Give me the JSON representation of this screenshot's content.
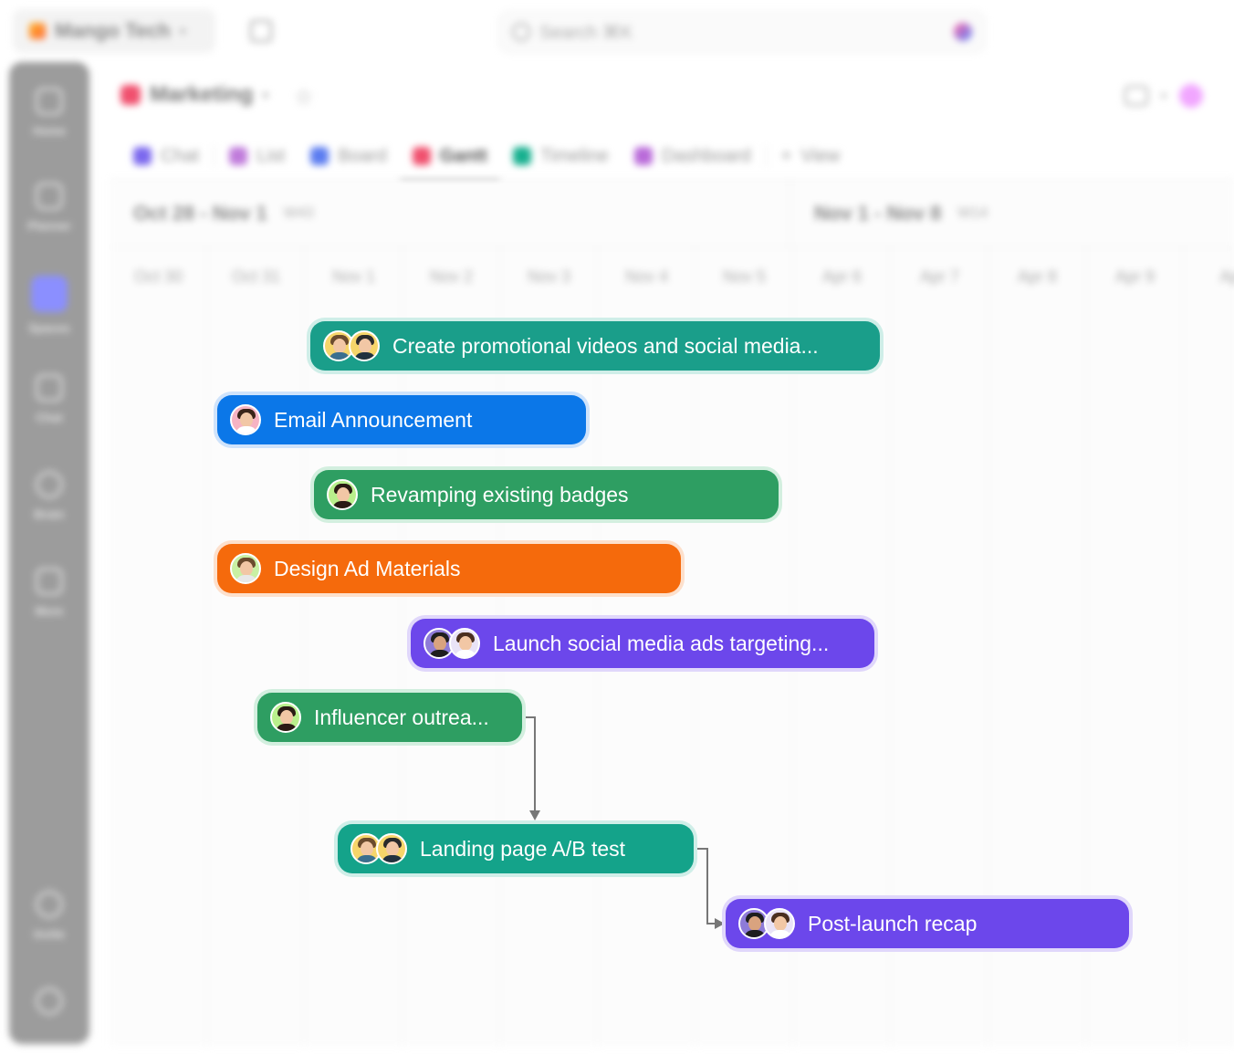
{
  "topbar": {
    "workspace_name": "Mango Tech",
    "search_placeholder": "Search ⌘K"
  },
  "sidebar": {
    "items": [
      {
        "label": "Home",
        "icon": "home-icon"
      },
      {
        "label": "Planner",
        "icon": "planner-icon"
      },
      {
        "label": "Spaces",
        "icon": "spaces-icon"
      },
      {
        "label": "Chat",
        "icon": "chat-icon"
      },
      {
        "label": "Brain",
        "icon": "brain-icon"
      },
      {
        "label": "More",
        "icon": "grid-icon"
      },
      {
        "label": "Invite",
        "icon": "invite-icon"
      },
      {
        "label": "",
        "icon": "help-icon"
      }
    ]
  },
  "header": {
    "space_name": "Marketing"
  },
  "tabs": [
    {
      "label": "Chat",
      "color": "#7b68ee"
    },
    {
      "label": "List",
      "color": "#c07bdb"
    },
    {
      "label": "Board",
      "color": "#5b7cf0"
    },
    {
      "label": "Gantt",
      "color": "#f0506e",
      "active": true
    },
    {
      "label": "Timeline",
      "color": "#17b08f"
    },
    {
      "label": "Dashboard",
      "color": "#b96ad9"
    },
    {
      "label": "View"
    }
  ],
  "weeks": [
    {
      "range": "Oct 28 - Nov 1",
      "num": "W43"
    },
    {
      "range": "Nov 1 - Nov 8",
      "num": "W14"
    }
  ],
  "days": [
    "Oct 30",
    "Oct 31",
    "Nov 1",
    "Nov 2",
    "Nov 3",
    "Nov 4",
    "Nov 5",
    "Apr 6",
    "Apr 7",
    "Apr 8",
    "Apr 9",
    "Apr"
  ],
  "tasks": [
    {
      "title": "Create promotional videos and social media...",
      "color": "#1a9e8a",
      "ring": "#cfeee8"
    },
    {
      "title": "Email Announcement",
      "color": "#0b77e8",
      "ring": "#cfe3fb"
    },
    {
      "title": "Revamping existing badges",
      "color": "#2e9e62",
      "ring": "#d3efdf"
    },
    {
      "title": "Design Ad Materials",
      "color": "#f56a0c",
      "ring": "#fde0cc"
    },
    {
      "title": "Launch social media ads targeting...",
      "color": "#6c47eb",
      "ring": "#e0d7fb"
    },
    {
      "title": "Influencer outrea...",
      "color": "#2e9e62",
      "ring": "#d3efdf"
    },
    {
      "title": "Landing page A/B test",
      "color": "#14a38a",
      "ring": "#cfeee8"
    },
    {
      "title": "Post-launch recap",
      "color": "#6c47eb",
      "ring": "#e0d7fb"
    }
  ]
}
